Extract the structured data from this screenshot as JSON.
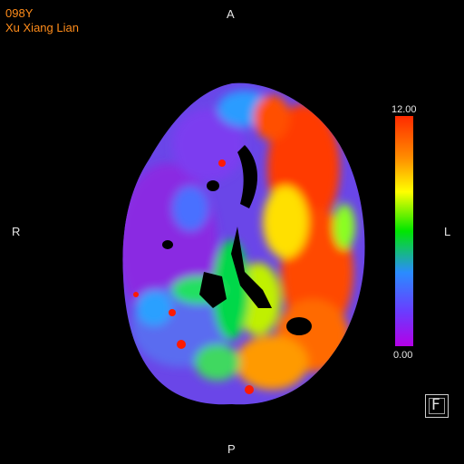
{
  "patient": {
    "age": "098Y",
    "name": "Xu Xiang Lian"
  },
  "orientation": {
    "top": "A",
    "left": "R",
    "right": "L",
    "bottom": "P"
  },
  "color_scale": {
    "max_label": "12.00",
    "min_label": "0.00",
    "max_value": 12.0,
    "min_value": 0.0,
    "colors": [
      "#ff2a00",
      "#ff8c00",
      "#ffff00",
      "#00e600",
      "#2a8cff",
      "#6a3cff",
      "#b400e6"
    ]
  },
  "overlay_colors": {
    "text": "#ff8c1a"
  },
  "controls": {
    "filter_icon": "F"
  }
}
